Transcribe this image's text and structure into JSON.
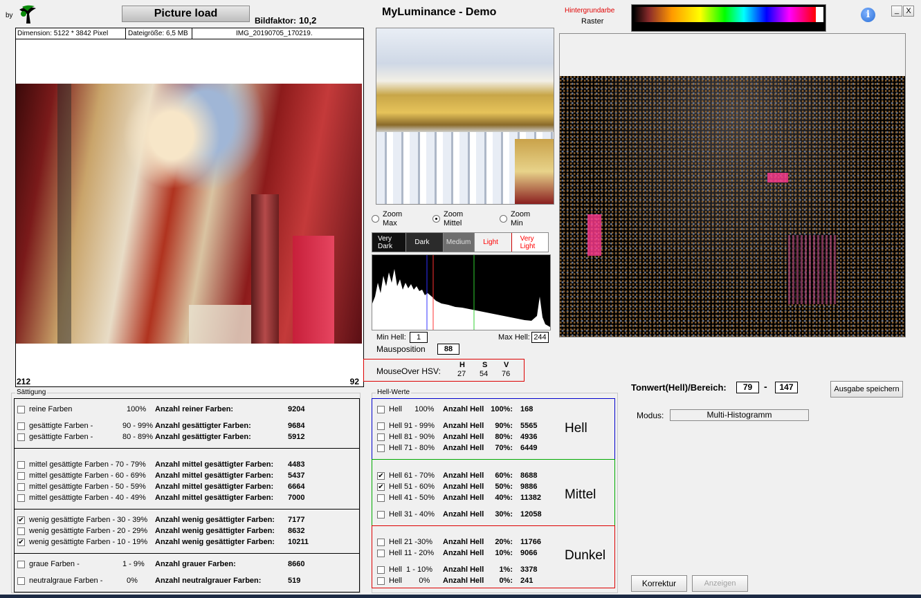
{
  "header": {
    "by": "by",
    "load_button": "Picture load",
    "bildfaktor_label": "Bildfaktor:",
    "bildfaktor_value": "10,2",
    "app_title": "MyLuminance - Demo",
    "hintergrund_label": "Hintergrundarbe",
    "raster_label": "Raster",
    "minimize": "_",
    "close": "X"
  },
  "image_info": {
    "dimension": "Dimension: 5122 * 3842 Pixel",
    "filesize": "Dateigröße: 6,5 MB",
    "filename": "IMG_20190705_170219.",
    "corner_left": "212",
    "corner_right": "92"
  },
  "zoom": {
    "options": [
      {
        "line1": "Zoom",
        "line2": "Max",
        "selected": false
      },
      {
        "line1": "Zoom",
        "line2": "Mittel",
        "selected": true
      },
      {
        "line1": "Zoom",
        "line2": "Min",
        "selected": false
      }
    ]
  },
  "tone_bands": [
    {
      "line1": "Very",
      "line2": "Dark",
      "bg": "#111111",
      "fg": "#ffffff"
    },
    {
      "line1": "Dark",
      "line2": "",
      "bg": "#2b2b2b",
      "fg": "#ffffff"
    },
    {
      "line1": "Medium",
      "line2": "",
      "bg": "#6e6e6e",
      "fg": "#e0e0e0"
    },
    {
      "line1": "Light",
      "line2": "",
      "bg": "#f0f0f0",
      "fg": "#ff0000"
    },
    {
      "line1": "Very",
      "line2": "Light",
      "bg": "#ffffff",
      "fg": "#ff0000"
    }
  ],
  "histogram": {
    "min_label": "Min Hell:",
    "min_value": "1",
    "max_label": "Max Hell:",
    "max_value": "244",
    "mouse_label": "Mausposition",
    "mouse_value": "88",
    "marker_colors": [
      "#3030ff",
      "#ff3030",
      "#30d030"
    ]
  },
  "hsv": {
    "label": "MouseOver HSV:",
    "h_label": "H",
    "s_label": "S",
    "v_label": "V",
    "h": "27",
    "s": "54",
    "v": "76"
  },
  "tonwert": {
    "label": "Tonwert(Hell)/Bereich:",
    "from": "79",
    "dash": "-",
    "to": "147",
    "save_button": "Ausgabe speichern",
    "modus_label": "Modus:",
    "modus_value": "Multi-Histogramm"
  },
  "bottom_buttons": {
    "korrektur": "Korrektur",
    "anzeigen": "Anzeigen"
  },
  "saettigung": {
    "title": "Sättigung",
    "rows": [
      {
        "check": false,
        "label": "reine Farben",
        "pct": "100%",
        "count_label": "Anzahl reiner Farben:",
        "value": "9204"
      },
      {
        "check": false,
        "label": "gesättigte Farben  -",
        "pct": "90 - 99%",
        "count_label": "Anzahl gesättigter Farben:",
        "value": "9684"
      },
      {
        "check": false,
        "label": "gesättigte Farben  -",
        "pct": "80 - 89%",
        "count_label": "Anzahl gesättigter Farben:",
        "value": "5912"
      },
      {
        "check": false,
        "label": "mittel gesättigte Farben  - 70 - 79%",
        "pct": "",
        "count_label": "Anzahl mittel gesättigter Farben:",
        "value": "4483"
      },
      {
        "check": false,
        "label": "mittel gesättigte Farben  - 60 - 69%",
        "pct": "",
        "count_label": "Anzahl mittel gesättigter Farben:",
        "value": "5437"
      },
      {
        "check": false,
        "label": "mittel gesättigte Farben  - 50 - 59%",
        "pct": "",
        "count_label": "Anzahl mittel gesättigter Farben:",
        "value": "6664"
      },
      {
        "check": false,
        "label": "mittel gesättigte Farben  - 40 - 49%",
        "pct": "",
        "count_label": "Anzahl mittel gesättigter Farben:",
        "value": "7000"
      },
      {
        "check": true,
        "label": "wenig gesättigte Farben - 30 - 39%",
        "pct": "",
        "count_label": "Anzahl wenig gesättigter Farben:",
        "value": "7177"
      },
      {
        "check": false,
        "label": "wenig gesättigte Farben - 20 - 29%",
        "pct": "",
        "count_label": "Anzahl wenig gesättigter Farben:",
        "value": "8632"
      },
      {
        "check": true,
        "label": "wenig gesättigte Farben - 10 - 19%",
        "pct": "",
        "count_label": "Anzahl wenig gesättigter Farben:",
        "value": "10211"
      },
      {
        "check": false,
        "label": "graue Farben -",
        "pct": "1 -  9%",
        "count_label": "Anzahl grauer Farben:",
        "value": "8660"
      },
      {
        "check": false,
        "label": "neutralgraue Farben -",
        "pct": "0%",
        "count_label": "Anzahl neutralgrauer Farben:",
        "value": "519"
      }
    ]
  },
  "hellwerte": {
    "title": "Hell-Werte",
    "group_hell": "Hell",
    "group_mittel": "Mittel",
    "group_dunkel": "Dunkel",
    "rows": [
      {
        "check": false,
        "label": "Hell      100%",
        "count_label": "Anzahl Hell",
        "pct": "100%:",
        "value": "168"
      },
      {
        "check": false,
        "label": "Hell 91 - 99%",
        "count_label": "Anzahl Hell",
        "pct": "90%:",
        "value": "5565"
      },
      {
        "check": false,
        "label": "Hell 81 - 90%",
        "count_label": "Anzahl Hell",
        "pct": "80%:",
        "value": "4936"
      },
      {
        "check": false,
        "label": "Hell 71 - 80%",
        "count_label": "Anzahl Hell",
        "pct": "70%:",
        "value": "6449"
      },
      {
        "check": true,
        "label": "Hell 61 - 70%",
        "count_label": "Anzahl Hell",
        "pct": "60%:",
        "value": "8688"
      },
      {
        "check": true,
        "label": "Hell 51 - 60%",
        "count_label": "Anzahl Hell",
        "pct": "50%:",
        "value": "9886"
      },
      {
        "check": false,
        "label": "Hell 41 - 50%",
        "count_label": "Anzahl Hell",
        "pct": "40%:",
        "value": "11382"
      },
      {
        "check": false,
        "label": "Hell 31 - 40%",
        "count_label": "Anzahl Hell",
        "pct": "30%:",
        "value": "12058"
      },
      {
        "check": false,
        "label": "Hell 21 -30%",
        "count_label": "Anzahl Hell",
        "pct": "20%:",
        "value": "11766"
      },
      {
        "check": false,
        "label": "Hell 11 - 20%",
        "count_label": "Anzahl Hell",
        "pct": "10%:",
        "value": "9066"
      },
      {
        "check": false,
        "label": "Hell  1 - 10%",
        "count_label": "Anzahl Hell",
        "pct": "1%:",
        "value": "3378"
      },
      {
        "check": false,
        "label": "Hell        0%",
        "count_label": "Anzahl Hell",
        "pct": "0%:",
        "value": "241"
      }
    ]
  },
  "colors": {
    "hell_border": "#0000cc",
    "mittel_border": "#00aa00",
    "dunkel_border": "#dd0000",
    "hsv_border": "#dd0000",
    "info_blue": "#2a6fd6"
  }
}
